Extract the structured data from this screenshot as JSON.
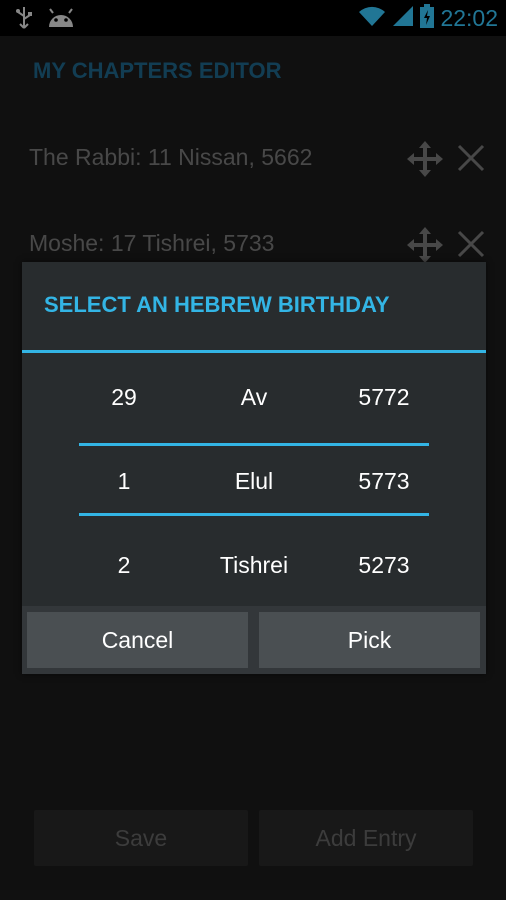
{
  "status_bar": {
    "time": "22:02",
    "icons": [
      "usb-icon",
      "android-icon",
      "wifi-icon",
      "signal-icon",
      "battery-charging-icon"
    ]
  },
  "app": {
    "title": "MY CHAPTERS EDITOR",
    "entries": [
      {
        "label": "The Rabbi: 11 Nissan, 5662"
      },
      {
        "label": "Moshe: 17 Tishrei, 5733"
      }
    ],
    "buttons": {
      "save": "Save",
      "add_entry": "Add Entry"
    }
  },
  "dialog": {
    "title": "SELECT AN HEBREW BIRTHDAY",
    "picker": {
      "day": {
        "prev": "29",
        "selected": "1",
        "next": "2"
      },
      "month": {
        "prev": "Av",
        "selected": "Elul",
        "next": "Tishrei"
      },
      "year": {
        "prev": "5772",
        "selected": "5773",
        "next": "5273"
      }
    },
    "buttons": {
      "cancel": "Cancel",
      "pick": "Pick"
    }
  },
  "colors": {
    "accent": "#33b5e5",
    "app_title": "#1d5f80",
    "dialog_bg": "#282c2e"
  }
}
